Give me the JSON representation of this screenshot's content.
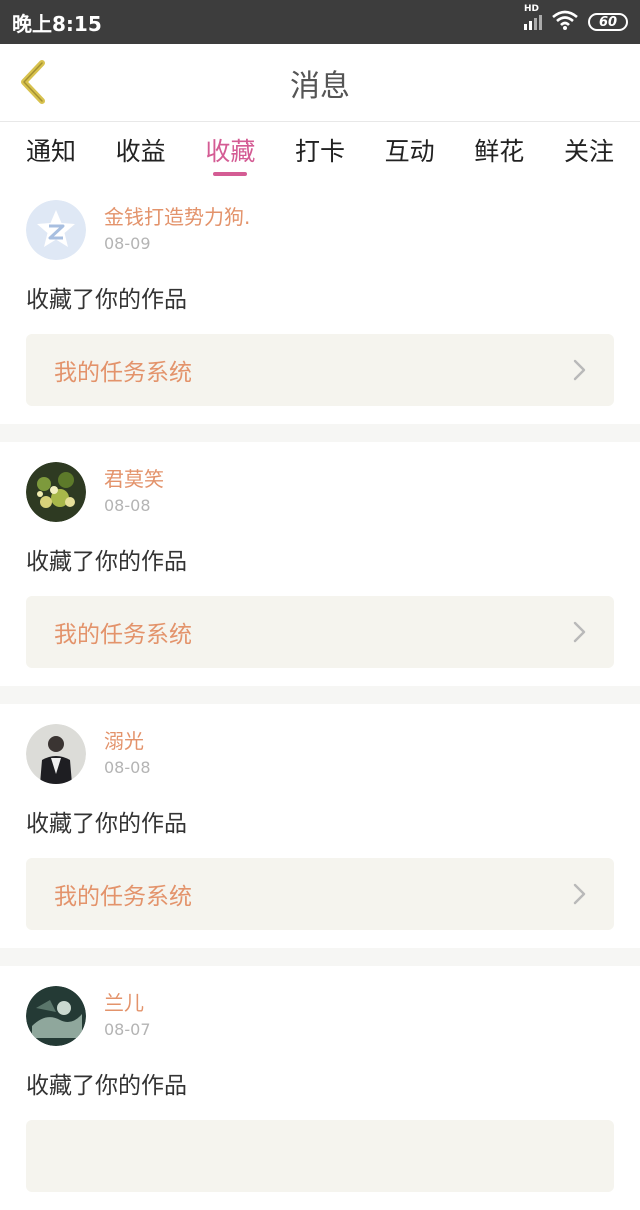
{
  "status_bar": {
    "time": "晚上8:15",
    "network": "HD",
    "battery": "60"
  },
  "header": {
    "title": "消息"
  },
  "tabs": [
    {
      "label": "通知"
    },
    {
      "label": "收益"
    },
    {
      "label": "收藏",
      "active": true
    },
    {
      "label": "打卡"
    },
    {
      "label": "互动"
    },
    {
      "label": "鲜花"
    },
    {
      "label": "关注"
    }
  ],
  "feed": [
    {
      "name": "金钱打造势力狗.",
      "date": "08-09",
      "action": "收藏了你的作品",
      "work": "我的任务系统"
    },
    {
      "name": "君莫笑",
      "date": "08-08",
      "action": "收藏了你的作品",
      "work": "我的任务系统"
    },
    {
      "name": "溺光",
      "date": "08-08",
      "action": "收藏了你的作品",
      "work": "我的任务系统"
    },
    {
      "name": "兰儿",
      "date": "08-07",
      "action": "收藏了你的作品",
      "work": ""
    }
  ],
  "colors": {
    "accent": "#d45c94",
    "name": "#e3936b",
    "back_arrow": "#d8c24e"
  }
}
